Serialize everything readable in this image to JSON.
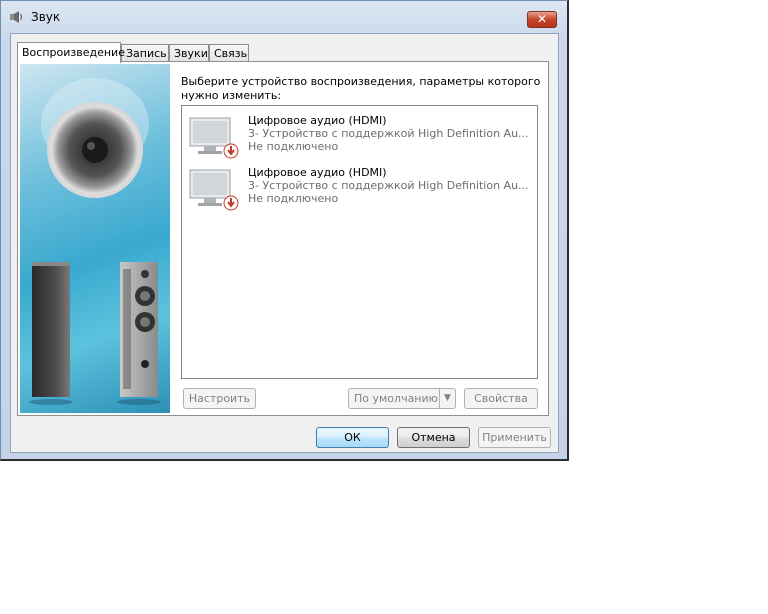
{
  "window": {
    "title": "Звук",
    "close_label": "✕"
  },
  "tabs": [
    {
      "label": "Воспроизведение"
    },
    {
      "label": "Запись"
    },
    {
      "label": "Звуки"
    },
    {
      "label": "Связь"
    }
  ],
  "instructions": "Выберите устройство воспроизведения, параметры которого нужно изменить:",
  "devices": [
    {
      "name": "Цифровое аудио (HDMI)",
      "description": "3- Устройство с поддержкой High Definition Au...",
      "status": "Не подключено"
    },
    {
      "name": "Цифровое аудио (HDMI)",
      "description": "3- Устройство с поддержкой High Definition Au...",
      "status": "Не подключено"
    }
  ],
  "panel_buttons": {
    "configure": "Настроить",
    "default": "По умолчанию",
    "properties": "Свойства"
  },
  "dialog_buttons": {
    "ok": "ОК",
    "cancel": "Отмена",
    "apply": "Применить"
  },
  "icons": {
    "title": "speaker-icon",
    "device": "monitor-disconnected-icon"
  },
  "colors": {
    "accent": "#3c7fb1",
    "close_button": "#c6452c",
    "art_background": "#39a8cf"
  }
}
